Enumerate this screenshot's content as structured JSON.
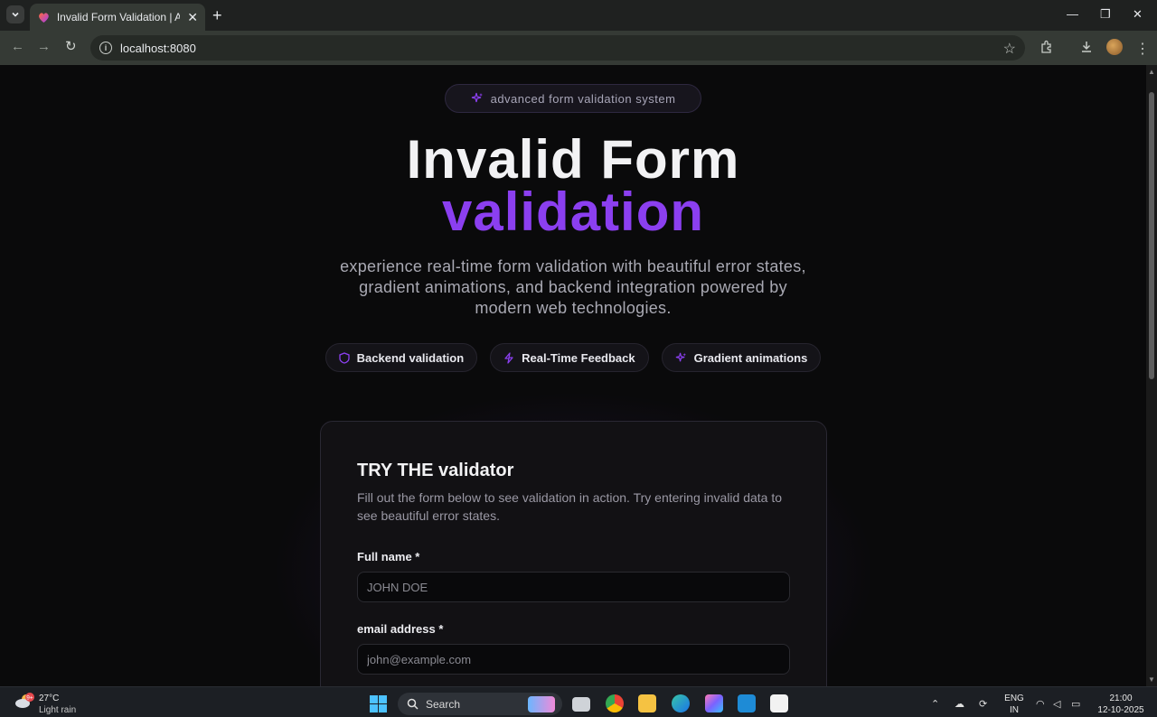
{
  "browser": {
    "tab_title": "Invalid Form Validation | Advanced",
    "url": "localhost:8080"
  },
  "page": {
    "badge": "advanced form validation system",
    "title_line1": "Invalid Form",
    "title_line2": "validation",
    "description": "experience real-time form validation with beautiful error states, gradient animations, and backend integration powered by modern web technologies.",
    "pills": [
      {
        "label": "Backend validation",
        "icon": "shield-icon"
      },
      {
        "label": "Real-Time Feedback",
        "icon": "lightning-icon"
      },
      {
        "label": "Gradient animations",
        "icon": "sparkle-icon"
      }
    ],
    "form": {
      "title": "TRY THE validator",
      "description": "Fill out the form below to see validation in action. Try entering invalid data to see beautiful error states.",
      "fields": [
        {
          "label": "Full name *",
          "placeholder": "JOHN DOE"
        },
        {
          "label": "email address *",
          "placeholder": "john@example.com"
        }
      ]
    }
  },
  "taskbar": {
    "temperature": "27°C",
    "weather": "Light rain",
    "weather_badge": "9+",
    "search_label": "Search",
    "language_top": "ENG",
    "language_bottom": "IN",
    "time": "21:00",
    "date": "12-10-2025"
  },
  "colors": {
    "accent": "#8b3ff0",
    "page_bg": "#0a0a0b",
    "card_bg": "#121114"
  }
}
